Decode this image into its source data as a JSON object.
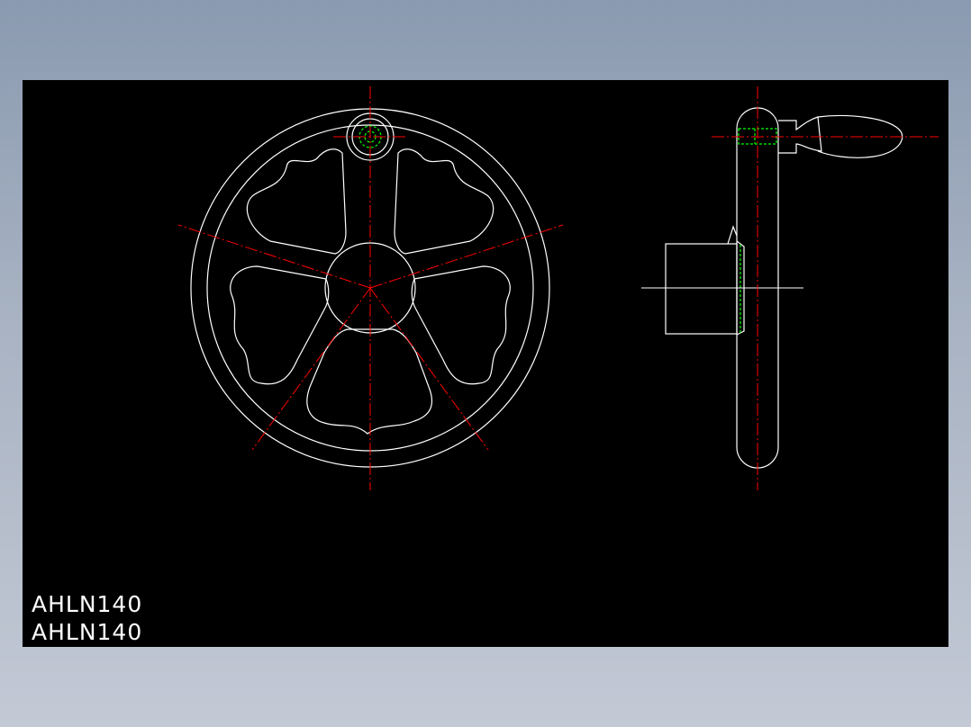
{
  "drawing": {
    "labels": [
      "AHLN140",
      "AHLN140"
    ],
    "colors": {
      "outline": "#ffffff",
      "centerline": "#ff0000",
      "hidden": "#00ff00",
      "background": "#000000"
    }
  }
}
